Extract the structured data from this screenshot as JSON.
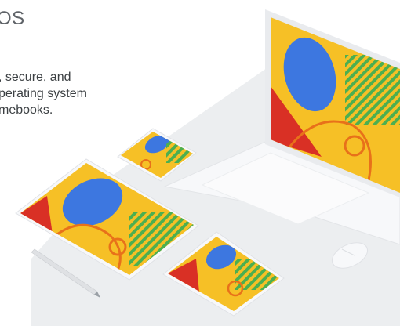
{
  "header": {
    "title_fragment": "OS"
  },
  "description": {
    "lines": [
      ", secure, and",
      "perating system",
      "mebooks."
    ]
  },
  "colors": {
    "yellow": "#f6c026",
    "blue": "#3d77e0",
    "red": "#d93025",
    "green": "#4caf50",
    "orange": "#e8711a",
    "text": "#3c4043",
    "title": "#5f6368",
    "device_white": "#f4f5f7",
    "floor": "#eceef0"
  },
  "illustration": {
    "devices": [
      "laptop-display",
      "phone",
      "tablet-large",
      "tablet-small",
      "stylus",
      "mouse"
    ]
  }
}
